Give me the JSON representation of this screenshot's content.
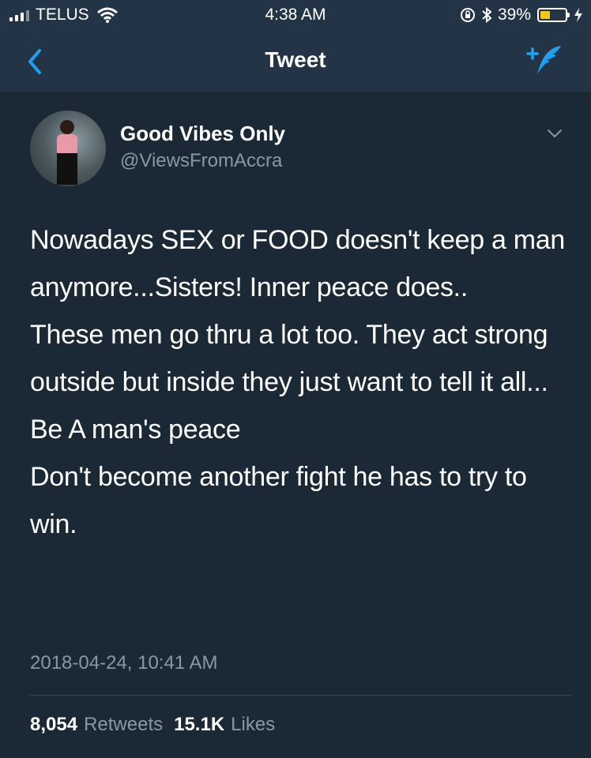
{
  "status_bar": {
    "carrier": "TELUS",
    "time": "4:38 AM",
    "battery": "39%",
    "battery_level": 0.39,
    "icons": [
      "signal-icon",
      "wifi-icon",
      "orientation-lock-icon",
      "bluetooth-icon",
      "battery-icon",
      "charging-icon"
    ]
  },
  "nav": {
    "title": "Tweet",
    "back_icon": "chevron-left-icon",
    "compose_icon": "compose-tweet-icon",
    "accent_color": "#1da1f2"
  },
  "tweet": {
    "display_name": "Good Vibes Only",
    "handle": "@ViewsFromAccra",
    "text": "Nowadays SEX or FOOD doesn't keep a man anymore...Sisters! Inner peace does..\nThese men go thru a lot too. They act strong outside but inside they just want to tell it all...\nBe A man's peace\nDon't become another fight he has to try to win.",
    "timestamp": "2018-04-24, 10:41 AM",
    "retweets_count": "8,054",
    "retweets_label": "Retweets",
    "likes_count": "15.1K",
    "likes_label": "Likes"
  },
  "colors": {
    "background": "#1b2836",
    "header": "#243447",
    "muted_text": "#8899a6"
  }
}
